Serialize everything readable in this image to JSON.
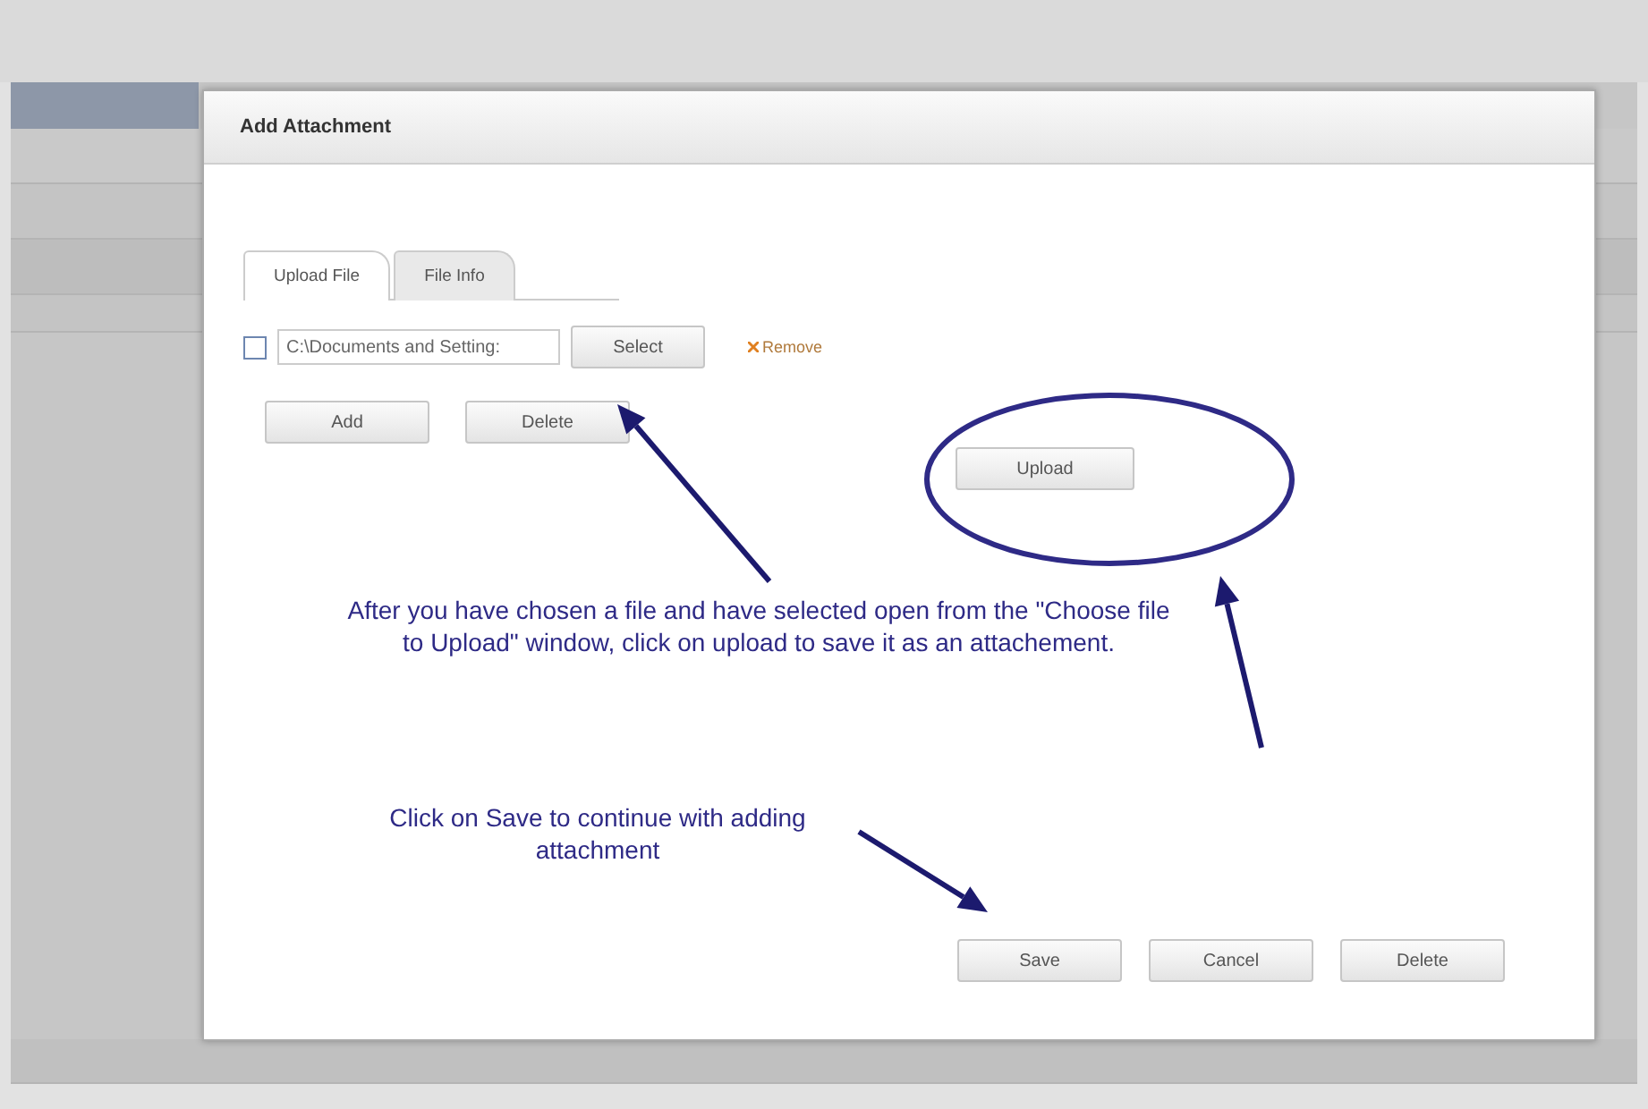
{
  "dialog": {
    "title": "Add Attachment",
    "tabs": [
      {
        "label": "Upload File",
        "selected": true
      },
      {
        "label": "File Info",
        "selected": false
      }
    ],
    "file_row": {
      "checked": false,
      "path": "C:\\Documents and Setting:",
      "select_button": "Select",
      "remove_link": "Remove"
    },
    "row_buttons": [
      "Add",
      "Delete"
    ],
    "upload_button": "Upload",
    "notes": [
      "After you have chosen a file and have selected open from the \"Choose file to Upload\" window, click on upload to save it as an attachement.",
      "Click on Save to continue with adding attachment"
    ],
    "footer_buttons": [
      "Save",
      "Cancel",
      "Delete"
    ]
  }
}
